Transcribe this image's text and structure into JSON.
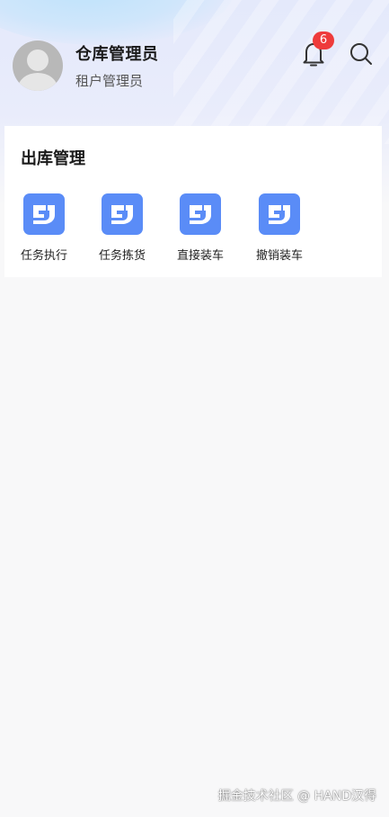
{
  "user": {
    "name": "仓库管理员",
    "role": "租户管理员"
  },
  "header": {
    "notification_count": "6",
    "bell_icon": "bell-icon",
    "search_icon": "search-icon"
  },
  "section": {
    "title": "出库管理",
    "items": [
      {
        "label": "任务执行",
        "icon": "app-logo-icon"
      },
      {
        "label": "任务拣货",
        "icon": "app-logo-icon"
      },
      {
        "label": "直接装车",
        "icon": "app-logo-icon"
      },
      {
        "label": "撤销装车",
        "icon": "app-logo-icon"
      }
    ]
  },
  "watermark": "掘金技术社区 @ HAND汉得",
  "colors": {
    "accent": "#5a8cf7",
    "badge": "#ee3b3b",
    "background": "#f8f8f9"
  }
}
